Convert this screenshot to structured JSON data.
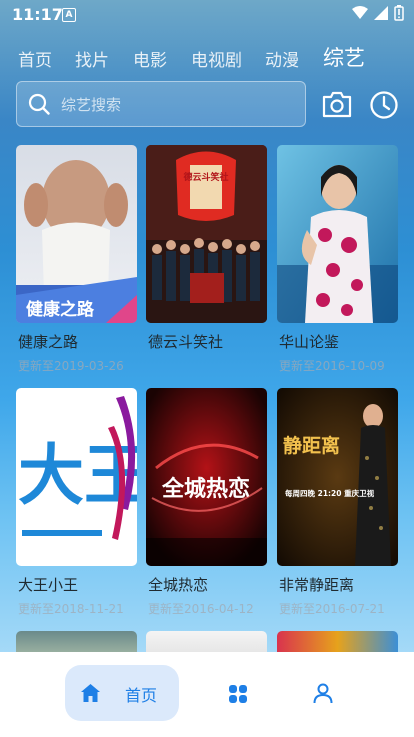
{
  "status": {
    "time": "11:17",
    "notification": "A"
  },
  "tabs": [
    {
      "label": "首页"
    },
    {
      "label": "找片"
    },
    {
      "label": "电影"
    },
    {
      "label": "电视剧"
    },
    {
      "label": "动漫"
    },
    {
      "label": "综艺",
      "active": true
    }
  ],
  "search": {
    "placeholder": "综艺搜索"
  },
  "cards": [
    {
      "title": "健康之路",
      "subtitle": "更新至2019-03-26",
      "poster_text": "健康之路"
    },
    {
      "title": "德云斗笑社",
      "subtitle": "",
      "poster_text": "德云斗笑社"
    },
    {
      "title": "华山论鉴",
      "subtitle": "更新至2016-10-09"
    },
    {
      "title": "大王小王",
      "subtitle": "更新至2018-11-21",
      "poster_text": "大王"
    },
    {
      "title": "全城热恋",
      "subtitle": "更新至2016-04-12",
      "poster_text": "全城热恋"
    },
    {
      "title": "非常静距离",
      "subtitle": "更新至2016-07-21",
      "poster_text": "静距离",
      "poster_subtext": "每周四晚 21:20 重庆卫视"
    }
  ],
  "bottom_nav": {
    "home_label": "首页"
  },
  "colors": {
    "accent": "#1e7fe6",
    "nav_active_bg": "#dbe9fb"
  }
}
